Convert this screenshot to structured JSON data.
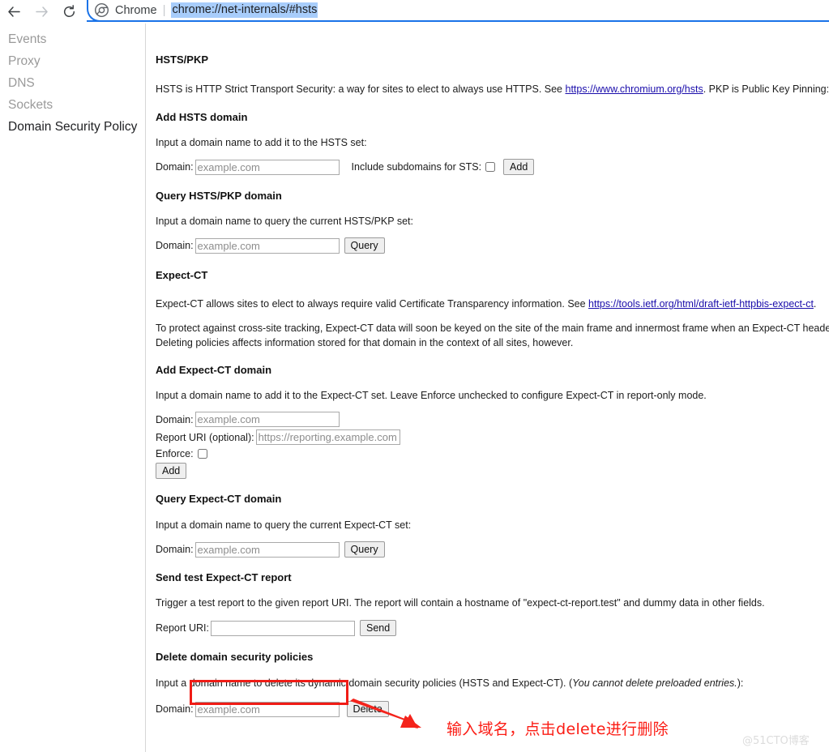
{
  "browser": {
    "back_icon": "arrow-left-icon",
    "forward_icon": "arrow-right-icon",
    "reload_icon": "reload-icon",
    "chrome_icon": "chrome-logo-icon",
    "brand_label": "Chrome",
    "separator": "|",
    "url": "chrome://net-internals/#hsts",
    "accent_color": "#1a73e8",
    "url_selection_color": "#a8cdfb"
  },
  "sidebar": {
    "items": [
      {
        "label": "Events",
        "active": false
      },
      {
        "label": "Proxy",
        "active": false
      },
      {
        "label": "DNS",
        "active": false
      },
      {
        "label": "Sockets",
        "active": false
      },
      {
        "label": "Domain Security Policy",
        "active": true
      }
    ]
  },
  "content": {
    "hsts": {
      "heading": "HSTS/PKP",
      "desc_pre": "HSTS is HTTP Strict Transport Security: a way for sites to elect to always use HTTPS. See ",
      "desc_link": "https://www.chromium.org/hsts",
      "desc_post": ". PKP is Public Key Pinning: Chrome \"p"
    },
    "add_hsts": {
      "heading": "Add HSTS domain",
      "instruction": "Input a domain name to add it to the HSTS set:",
      "domain_label": "Domain:",
      "domain_placeholder": "example.com",
      "domain_value": "",
      "subdomains_label": "Include subdomains for STS:",
      "subdomains_checked": false,
      "add_label": "Add"
    },
    "query_hsts": {
      "heading": "Query HSTS/PKP domain",
      "instruction": "Input a domain name to query the current HSTS/PKP set:",
      "domain_label": "Domain:",
      "domain_placeholder": "example.com",
      "domain_value": "",
      "query_label": "Query"
    },
    "expect_ct": {
      "heading": "Expect-CT",
      "desc_pre": "Expect-CT allows sites to elect to always require valid Certificate Transparency information. See ",
      "desc_link": "https://tools.ietf.org/html/draft-ietf-httpbis-expect-ct",
      "desc_post": ".",
      "note_line1": "To protect against cross-site tracking, Expect-CT data will soon be keyed on the site of the main frame and innermost frame when an Expect-CT header is en",
      "note_line2": "Deleting policies affects information stored for that domain in the context of all sites, however."
    },
    "add_expect_ct": {
      "heading": "Add Expect-CT domain",
      "instruction": "Input a domain name to add it to the Expect-CT set. Leave Enforce unchecked to configure Expect-CT in report-only mode.",
      "domain_label": "Domain:",
      "domain_placeholder": "example.com",
      "domain_value": "",
      "report_uri_label": "Report URI (optional):",
      "report_uri_placeholder": "https://reporting.example.com",
      "report_uri_value": "",
      "enforce_label": "Enforce:",
      "enforce_checked": false,
      "add_label": "Add"
    },
    "query_expect_ct": {
      "heading": "Query Expect-CT domain",
      "instruction": "Input a domain name to query the current Expect-CT set:",
      "domain_label": "Domain:",
      "domain_placeholder": "example.com",
      "domain_value": "",
      "query_label": "Query"
    },
    "send_report": {
      "heading": "Send test Expect-CT report",
      "instruction": "Trigger a test report to the given report URI. The report will contain a hostname of \"expect-ct-report.test\" and dummy data in other fields.",
      "report_uri_label": "Report URI:",
      "report_uri_placeholder": "",
      "report_uri_value": "",
      "send_label": "Send"
    },
    "delete": {
      "heading": "Delete domain security policies",
      "instruction_pre": "Input a domain name to delete its dynamic domain security policies (HSTS and Expect-CT). (",
      "instruction_italic": "You cannot delete preloaded entries.",
      "instruction_post": "):",
      "domain_label": "Domain:",
      "domain_placeholder": "example.com",
      "domain_value": "",
      "delete_label": "Delete"
    }
  },
  "annotation": {
    "text": "输入域名，点击delete进行删除",
    "color": "#fb1c14",
    "highlight_color": "#f01c16",
    "arrow_icon": "red-arrow-icon",
    "watermark": "@51CTO博客"
  }
}
